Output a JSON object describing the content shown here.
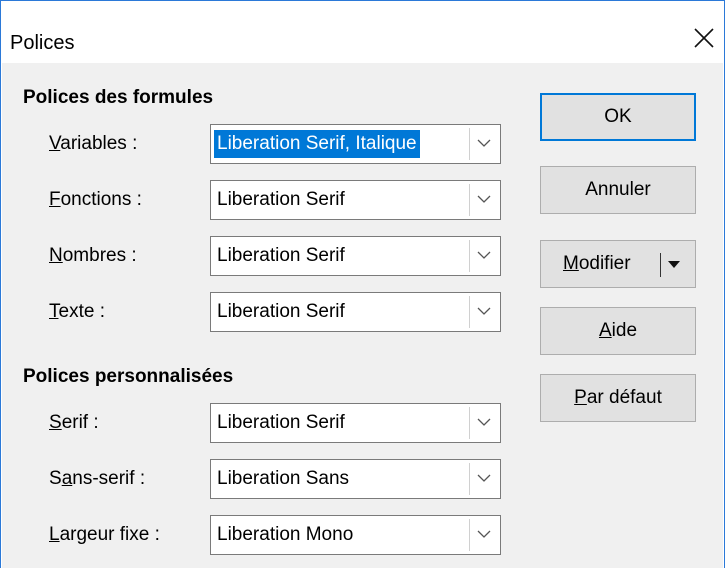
{
  "window": {
    "title": "Polices"
  },
  "formula_fonts": {
    "heading": "Polices des formules",
    "rows": [
      {
        "label_ul": "V",
        "label_rest": "ariables :",
        "value": "Liberation Serif, Italique",
        "selected": true
      },
      {
        "label_ul": "F",
        "label_rest": "onctions :",
        "value": "Liberation Serif"
      },
      {
        "label_ul": "N",
        "label_rest": "ombres :",
        "value": "Liberation Serif"
      },
      {
        "label_ul": "T",
        "label_rest": "exte :",
        "value": "Liberation Serif"
      }
    ]
  },
  "custom_fonts": {
    "heading": "Polices personnalisées",
    "rows": [
      {
        "label_pre": "",
        "label_ul": "S",
        "label_rest": "erif :",
        "value": "Liberation Serif"
      },
      {
        "label_pre": "S",
        "label_ul": "a",
        "label_rest": "ns-serif :",
        "value": "Liberation Sans"
      },
      {
        "label_pre": "",
        "label_ul": "L",
        "label_rest": "argeur fixe :",
        "value": "Liberation Mono"
      }
    ]
  },
  "buttons": {
    "ok": "OK",
    "cancel": "Annuler",
    "modify_ul": "M",
    "modify_rest": "odifier",
    "help_ul": "A",
    "help_rest": "ide",
    "default_ul": "P",
    "default_rest": "ar défaut"
  },
  "icons": {
    "close": "close-icon",
    "dropdown": "chevron-down-icon",
    "split": "triangle-down-icon"
  },
  "colors": {
    "accent": "#0078d7",
    "window_border": "#2b79d8",
    "button_face": "#e1e1e1",
    "dialog_bg": "#f0f0f0"
  }
}
